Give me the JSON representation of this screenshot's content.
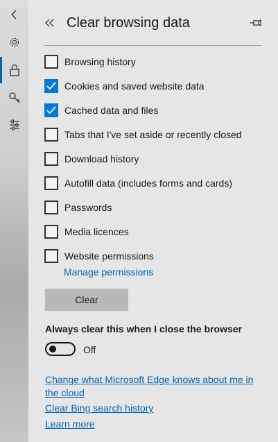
{
  "rail": {
    "items": [
      {
        "icon": "back-arrow-icon"
      },
      {
        "icon": "gear-icon"
      },
      {
        "icon": "lock-icon",
        "selected": true
      },
      {
        "icon": "key-icon"
      },
      {
        "icon": "sliders-icon"
      }
    ],
    "accent": "#0063b1"
  },
  "header": {
    "title": "Clear browsing data",
    "collapse_icon": "double-chevron-left-icon",
    "pin_icon": "pin-icon"
  },
  "options": [
    {
      "label": "Browsing history",
      "checked": false
    },
    {
      "label": "Cookies and saved website data",
      "checked": true
    },
    {
      "label": "Cached data and files",
      "checked": true
    },
    {
      "label": "Tabs that I've set aside or recently closed",
      "checked": false
    },
    {
      "label": "Download history",
      "checked": false
    },
    {
      "label": "Autofill data (includes forms and cards)",
      "checked": false
    },
    {
      "label": "Passwords",
      "checked": false
    },
    {
      "label": "Media licences",
      "checked": false
    },
    {
      "label": "Website permissions",
      "checked": false
    }
  ],
  "manage_permissions": "Manage permissions",
  "clear_button": "Clear",
  "always_clear": {
    "label": "Always clear this when I close the browser",
    "state": "Off"
  },
  "links": {
    "change_cloud": "Change what Microsoft Edge knows about me in the cloud",
    "clear_bing": "Clear Bing search history",
    "learn_more": "Learn more"
  },
  "colors": {
    "checkbox_checked": "#0078d7",
    "link": "#0063b1",
    "panel_bg": "#e6e6e6"
  }
}
